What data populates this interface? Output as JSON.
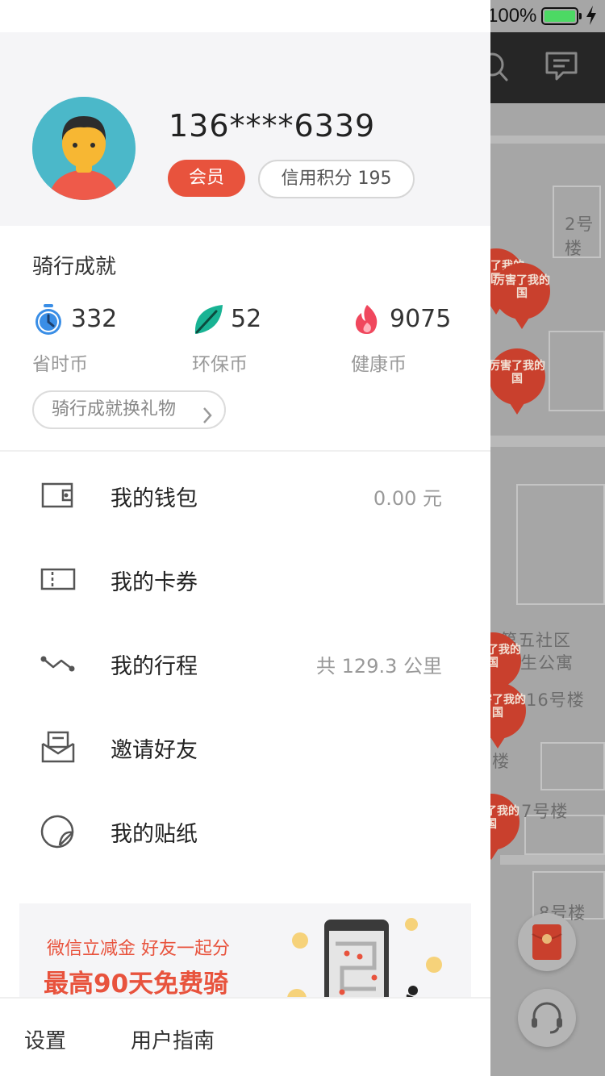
{
  "status_bar": {
    "battery_percent": "100%",
    "charging": true
  },
  "profile": {
    "phone": "136****6339",
    "member_badge": "会员",
    "credit_label": "信用积分 195"
  },
  "achievements": {
    "title": "骑行成就",
    "stats": [
      {
        "value": "332",
        "label": "省时币",
        "icon": "stopwatch-icon",
        "color": "#3a8ee6"
      },
      {
        "value": "52",
        "label": "环保币",
        "icon": "leaf-icon",
        "color": "#19b394"
      },
      {
        "value": "9075",
        "label": "健康币",
        "icon": "flame-icon",
        "color": "#f0475d"
      }
    ],
    "exchange_label": "骑行成就换礼物"
  },
  "menu": [
    {
      "label": "我的钱包",
      "value": "0.00 元",
      "icon": "wallet-icon"
    },
    {
      "label": "我的卡券",
      "value": "",
      "icon": "ticket-icon"
    },
    {
      "label": "我的行程",
      "value": "共 129.3 公里",
      "icon": "route-icon"
    },
    {
      "label": "邀请好友",
      "value": "",
      "icon": "envelope-icon"
    },
    {
      "label": "我的贴纸",
      "value": "",
      "icon": "sticker-icon"
    }
  ],
  "promo": {
    "line1": "微信立减金 好友一起分",
    "line2": "最高90天免费骑"
  },
  "bottom": {
    "settings": "设置",
    "guide": "用户指南"
  },
  "map": {
    "labels": [
      "2号楼",
      "第五社区",
      "生公寓",
      "16号楼",
      "7号楼",
      "8号楼",
      "楼"
    ],
    "pin_text": "厉害了我的国"
  },
  "colors": {
    "accent": "#e8533d",
    "map_topbar": "#262626"
  }
}
